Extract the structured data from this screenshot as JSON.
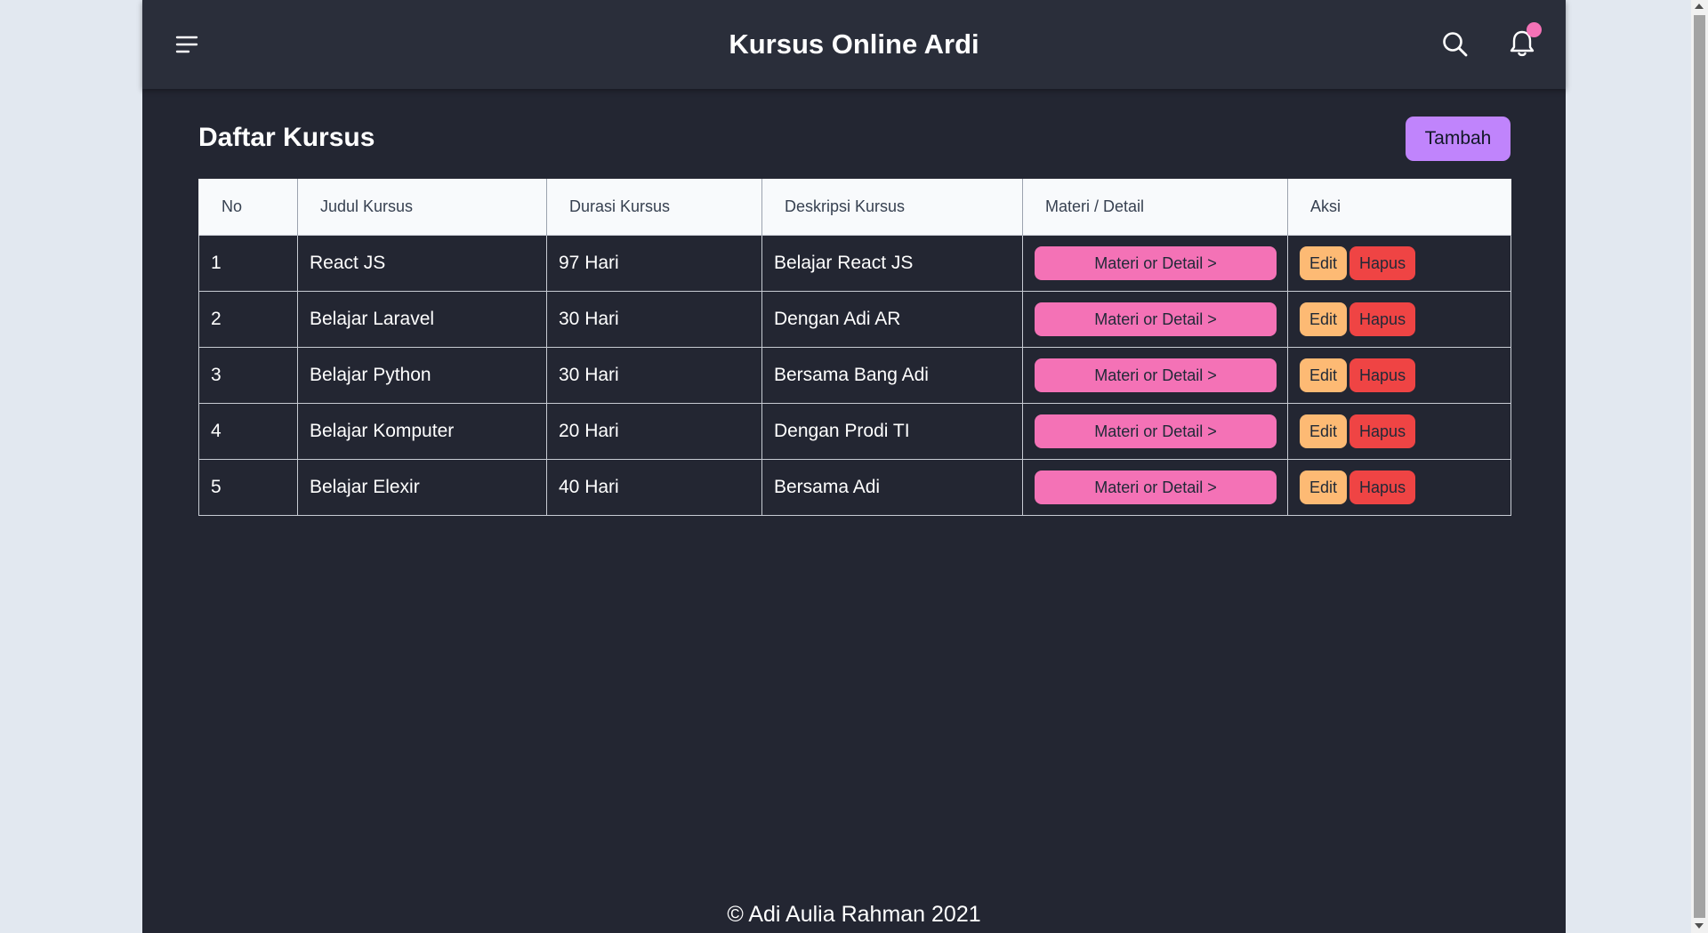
{
  "navbar": {
    "title": "Kursus Online Ardi",
    "menu_icon": "menu-icon",
    "search_icon": "search-icon",
    "bell_icon": "bell-icon"
  },
  "main": {
    "heading": "Daftar Kursus",
    "add_label": "Tambah"
  },
  "table": {
    "headers": [
      "No",
      "Judul Kursus",
      "Durasi Kursus",
      "Deskripsi Kursus",
      "Materi / Detail",
      "Aksi"
    ],
    "rows": [
      {
        "no": "1",
        "title": "React JS",
        "duration": "97 Hari",
        "description": "Belajar React JS",
        "detail_label": "Materi or Detail >",
        "edit_label": "Edit",
        "delete_label": "Hapus"
      },
      {
        "no": "2",
        "title": "Belajar Laravel",
        "duration": "30 Hari",
        "description": "Dengan Adi AR",
        "detail_label": "Materi or Detail >",
        "edit_label": "Edit",
        "delete_label": "Hapus"
      },
      {
        "no": "3",
        "title": "Belajar Python",
        "duration": "30 Hari",
        "description": "Bersama Bang Adi",
        "detail_label": "Materi or Detail >",
        "edit_label": "Edit",
        "delete_label": "Hapus"
      },
      {
        "no": "4",
        "title": "Belajar Komputer",
        "duration": "20 Hari",
        "description": "Dengan Prodi TI",
        "detail_label": "Materi or Detail >",
        "edit_label": "Edit",
        "delete_label": "Hapus"
      },
      {
        "no": "5",
        "title": "Belajar Elexir",
        "duration": "40 Hari",
        "description": "Bersama Adi",
        "detail_label": "Materi or Detail >",
        "edit_label": "Edit",
        "delete_label": "Hapus"
      }
    ]
  },
  "footer": {
    "text": "© Adi Aulia Rahman 2021"
  },
  "colors": {
    "page_bg": "#232632",
    "navbar_bg": "#2a2e3a",
    "add_button": "#c084fc",
    "detail_button": "#f472b6",
    "edit_button": "#fdba74",
    "delete_button": "#ef4444",
    "notification_badge": "#f472b6"
  }
}
